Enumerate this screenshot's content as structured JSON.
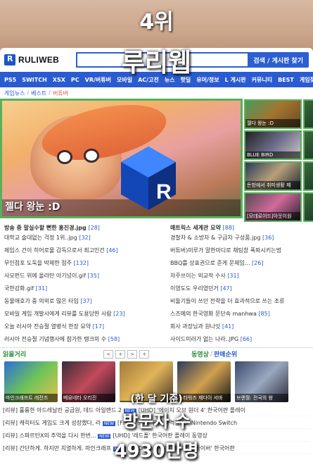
{
  "overlay": {
    "rank": "4위",
    "site_name": "루리웹",
    "basis": "(한 달 기준)",
    "visitors_label": "방문자 수",
    "visitors_value": "4930만명"
  },
  "header": {
    "logo_text": "RULIWEB",
    "search_button": "검색 / 게시판 찾기"
  },
  "nav": {
    "items": [
      "PS5",
      "SWITCH",
      "XSX",
      "PC",
      "VR/버튜버",
      "모바일",
      "AC/고전",
      "뉴스",
      "핫딜",
      "유머/정보",
      "L 게시판",
      "커뮤니티",
      "BEST",
      "게임찾기"
    ]
  },
  "breadcrumb": {
    "a": "게임뉴스",
    "b": "베스트",
    "c": "버튜버"
  },
  "hero": {
    "title": "젤다 왕눈 :D"
  },
  "thumbs": [
    {
      "caption": "젤다 왕눈 :D"
    },
    {
      "caption": "BLUE BIRD"
    },
    {
      "caption": "돈방에서 취미생활 제"
    },
    {
      "caption": "[모데로이드]아웃이원"
    }
  ],
  "left_list": {
    "title": "방송 중 말실수할 뻔한 홍진경.jpg",
    "title_count": "[28]",
    "items": [
      {
        "text": "대학교 술대없는 걱정 1위..jpg",
        "count": "[32]"
      },
      {
        "text": "제임스 건이 히어로물 감독으로서 최고인건",
        "count": "[46]"
      },
      {
        "text": "무인점포 도둑을 박제한 점주",
        "count": "[132]"
      },
      {
        "text": "사모펀드 위에 올라탄 아기넝이.gif",
        "count": "[35]"
      },
      {
        "text": "국한강화.gif",
        "count": "[31]"
      },
      {
        "text": "동물애호가 중 의외로 많은 타입",
        "count": "[37]"
      },
      {
        "text": "모바일 게임 개발사에게 리뷰를 도용당한 사람",
        "count": "[23]"
      },
      {
        "text": "오늘 러시아 전승절 열병식 한장 요약",
        "count": "[17]"
      },
      {
        "text": "러시아 전승절 기념행사에 참가한 탱크의 수",
        "count": "[58]"
      }
    ]
  },
  "right_list": {
    "title": "매트릭스 세계관 요약",
    "title_count": "[88]",
    "items": [
      {
        "text": "경찰차 & 소방차 & 구급차 구성품.jpg",
        "count": "[36]"
      },
      {
        "text": "버튜버)미루가 말한마디로 채팅창 폭파시키는법",
        "count": ""
      },
      {
        "text": "BBQ를 상표권으로 준게 문제임...",
        "count": "[26]"
      },
      {
        "text": "자주쓰이는 외교적 수사",
        "count": "[31]"
      },
      {
        "text": "이영도도 우리였던거",
        "count": "[47]"
      },
      {
        "text": "비둘기들이 쓰던 전략을 더 효과적으로 쓰는 조류",
        "count": ""
      },
      {
        "text": "스즈메의 한국영화 문단속 manhwa",
        "count": "[85]"
      },
      {
        "text": "회사 과장님과 원나잇",
        "count": "[41]"
      },
      {
        "text": "사이드미러가 없는 나라..JPG",
        "count": "[66]"
      }
    ]
  },
  "bottom": {
    "left_head": "읽을거리",
    "right_head_a": "동영상",
    "right_head_b": "판매순위",
    "pager": [
      "<",
      "+",
      ">",
      "+"
    ],
    "videos": [
      {
        "caption": "마인크래프트 레전즈"
      },
      {
        "caption": "베요네타 오리진"
      },
      {
        "caption": ""
      },
      {
        "caption": "스타워즈 제다이 서바"
      },
      {
        "caption": "브렌월: 전국의 왕"
      }
    ],
    "news": [
      {
        "left": "[리뷰] 훌륭한 아드레날린 공급원, 데드 아일랜드 2",
        "tag": "NEW",
        "right": "[UHD] '에이지 오브 원더 4' 한국어판 플레이"
      },
      {
        "left": "[리뷰] 캐릭터도 게임도 크게 성장했다, 라",
        "tag": "NEW",
        "right": "[FHD] '혹시? 유령 사격장 for Nintendo Switch"
      },
      {
        "left": "[리뷰] 스파르탄X의 추억을 다시 한번...",
        "tag": "NEW",
        "right": "[UHD] '레드폴' 한국어판 플레이 동영상"
      },
      {
        "left": "[리뷰] 간단하게. 하지만 치열하게. 마인크래프",
        "tag": "NEW",
        "right": "[UHD] '스타워즈 제다이: 서바이버' 한국어판"
      }
    ]
  },
  "colors": {
    "brand_blue": "#2a5bd0",
    "highlight_green": "#56b15a",
    "link_red": "#e0544b"
  }
}
